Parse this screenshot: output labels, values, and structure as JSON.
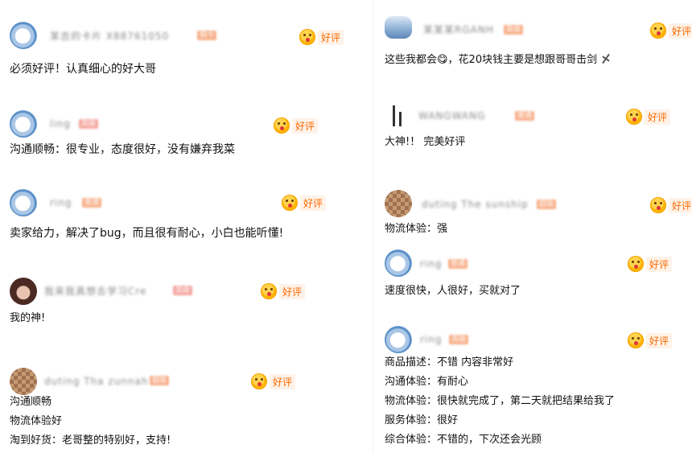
{
  "tag_label": "好评",
  "left": [
    {
      "name": "某吉的卡片 X88761050",
      "badge": "铜卡",
      "text": [
        "必须好评！认真细心的好大哥"
      ]
    },
    {
      "name": "ling",
      "badge": "高级",
      "text": [
        "沟通顺畅：很专业，态度很好，没有嫌弃我菜"
      ]
    },
    {
      "name": "ring",
      "badge": "普通",
      "text": [
        "卖家给力，解决了bug，而且很有耐心，小白也能听懂!"
      ]
    },
    {
      "name": "我来我真想去学习Cre",
      "badge": "高级",
      "text": [
        "我的神!"
      ]
    },
    {
      "name": "duting Tha zunnah",
      "badge": "超级",
      "text": [
        "沟通顺畅",
        "物流体验好",
        "淘到好货：老哥整的特别好，支持!"
      ]
    }
  ],
  "right": [
    {
      "name": "某某某RGANH",
      "badge": "高级",
      "text": [
        "这些我都会😋，花20块钱主要是想跟哥哥击剑"
      ]
    },
    {
      "name": "WANGWANG",
      "badge": "普通",
      "text": [
        "大神!！ 完美好评"
      ]
    },
    {
      "name": "duting The sunship",
      "badge": "超级",
      "text": [
        "物流体验：强"
      ]
    },
    {
      "name": "ring",
      "badge": "普通",
      "text": [
        "速度很快，人很好，买就对了"
      ]
    },
    {
      "name": "ring",
      "badge": "高级",
      "text": [
        "商品描述：不错 内容非常好",
        "沟通体验：有耐心",
        "物流体验：很快就完成了，第二天就把结果给我了",
        "服务体验：很好",
        "综合体验：不错的，下次还会光顾"
      ]
    }
  ],
  "icons": {
    "sword": "sword-emoji-icon",
    "tag_emoji": "smile-blush-emoji-icon"
  },
  "colors": {
    "tag_text": "#ff6a00",
    "tag_bg": "#fff2e8",
    "name_gray": "#8a8a8a"
  }
}
